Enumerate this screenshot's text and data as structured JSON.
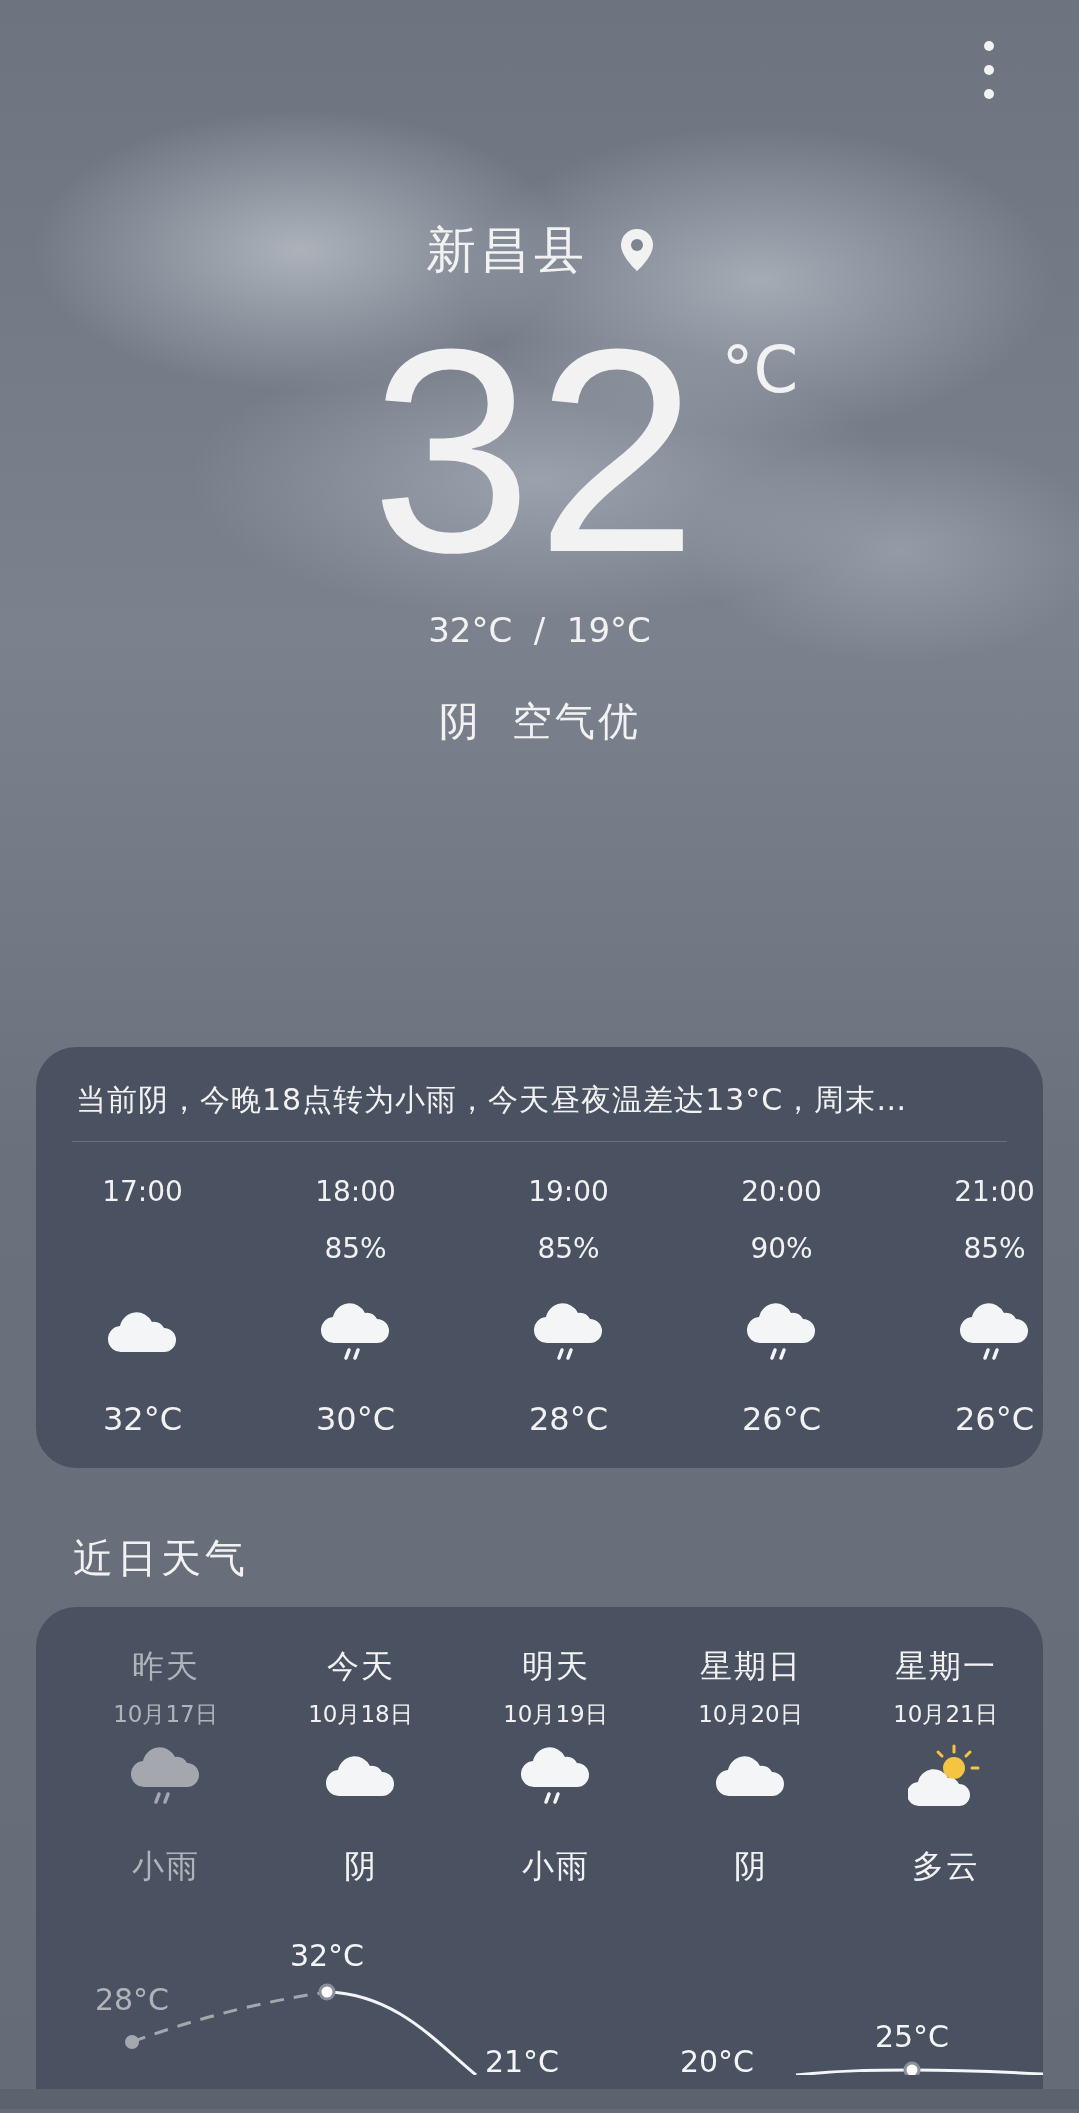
{
  "header": {
    "city": "新昌县",
    "temperature": "32",
    "unit": "°C",
    "range": "32°C  /  19°C",
    "weather": "阴",
    "air": "空气优"
  },
  "hourly": {
    "summary": "当前阴，今晚18点转为小雨，今天昼夜温差达13°C，周末…",
    "hours": [
      {
        "time": "17:00",
        "kind": "cloudy",
        "temp": "32°C"
      },
      {
        "time": "18:00",
        "precip": "85%",
        "kind": "rain",
        "temp": "30°C"
      },
      {
        "time": "19:00",
        "precip": "85%",
        "kind": "rain",
        "temp": "28°C"
      },
      {
        "time": "20:00",
        "precip": "90%",
        "kind": "rain",
        "temp": "26°C"
      },
      {
        "time": "21:00",
        "precip": "85%",
        "kind": "rain",
        "temp": "26°C"
      }
    ]
  },
  "daily": {
    "title": "近日天气",
    "days": [
      {
        "day": "昨天",
        "date": "10月17日",
        "kind": "rain",
        "condition": "小雨",
        "temp": "28°C",
        "past": true
      },
      {
        "day": "今天",
        "date": "10月18日",
        "kind": "cloudy",
        "condition": "阴",
        "temp": "32°C",
        "past": false
      },
      {
        "day": "明天",
        "date": "10月19日",
        "kind": "rain",
        "condition": "小雨",
        "temp": "21°C",
        "past": false
      },
      {
        "day": "星期日",
        "date": "10月20日",
        "kind": "cloudy",
        "condition": "阴",
        "temp": "20°C",
        "past": false
      },
      {
        "day": "星期一",
        "date": "10月21日",
        "kind": "partly-cloudy",
        "condition": "多云",
        "temp": "25°C",
        "past": false
      }
    ]
  }
}
